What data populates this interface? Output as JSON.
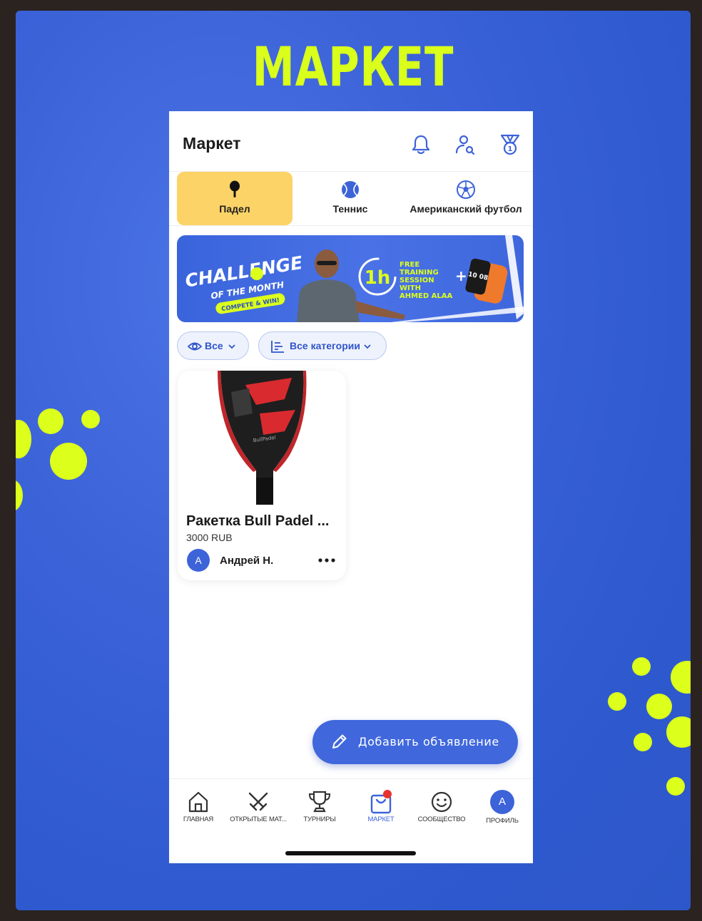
{
  "poster": {
    "title": "МАРКЕТ"
  },
  "header": {
    "title": "Маркет",
    "icons": [
      "bell-icon",
      "user-search-icon",
      "medal-icon"
    ]
  },
  "sports_tabs": [
    {
      "label": "Падел",
      "icon": "padel-racket-icon",
      "active": true
    },
    {
      "label": "Теннис",
      "icon": "tennis-ball-icon",
      "active": false
    },
    {
      "label": "Американский футбол",
      "icon": "soccer-ball-icon",
      "active": false
    }
  ],
  "banner": {
    "headline": "CHALLENGE",
    "subline": "OF THE MONTH",
    "tag": "COMPETE & WIN!",
    "duration": "1h",
    "offer_lines": [
      "FREE",
      "TRAINING",
      "SESSION",
      "WITH",
      "AHMED ALAA"
    ],
    "watch_time": "10 08"
  },
  "filters": {
    "visibility": "Все",
    "category": "Все категории"
  },
  "listings": [
    {
      "title": "Ракетка Bull Padel ...",
      "price": "3000 RUB",
      "seller": "Андрей Н.",
      "avatar_letter": "А"
    }
  ],
  "fab": {
    "label": "Добавить объявление"
  },
  "bottom_nav": [
    {
      "label": "ГЛАВНАЯ",
      "icon": "home-icon"
    },
    {
      "label": "ОТКРЫТЫЕ МАТ...",
      "icon": "crossed-swords-icon"
    },
    {
      "label": "ТУРНИРЫ",
      "icon": "trophy-icon"
    },
    {
      "label": "МАРКЕТ",
      "icon": "shopping-bag-icon",
      "active": true
    },
    {
      "label": "СООБЩЕСТВО",
      "icon": "smiley-icon"
    },
    {
      "label": "ПРОФИЛЬ",
      "icon": "profile-avatar",
      "avatar_letter": "А"
    }
  ],
  "colors": {
    "accent": "#3d63d9",
    "active_tab": "#fcd366",
    "poster_yellow": "#dcff1c",
    "notification_dot": "#e8322f"
  }
}
